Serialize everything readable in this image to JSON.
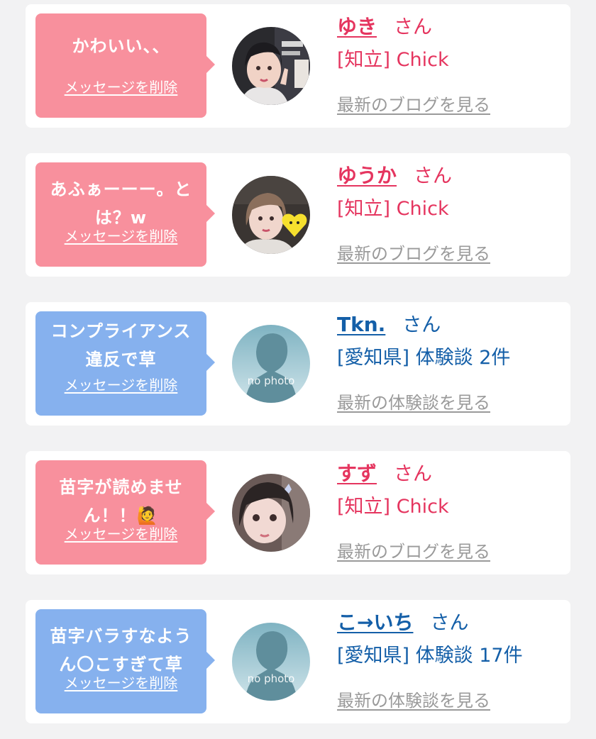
{
  "cards": [
    {
      "message": "かわいい、、",
      "delete_label": "メッセージを削除",
      "name": "ゆき",
      "honorific": "さん",
      "meta": "[知立] Chick",
      "link": "最新のブログを見る",
      "bubble_color": "#f8909d",
      "avatar": "photo-avatar"
    },
    {
      "message": "あふぁーーー。と\nは？w",
      "delete_label": "メッセージを削除",
      "name": "ゆうか",
      "honorific": "さん",
      "meta": "[知立] Chick",
      "link": "最新のブログを見る",
      "bubble_color": "#f8909d",
      "avatar": "photo-avatar"
    },
    {
      "message": "コンプライアンス\n違反で草",
      "delete_label": "メッセージを削除",
      "name": "Tkn.",
      "honorific": "さん",
      "meta": "[愛知県] 体験談 2件",
      "link": "最新の体験談を見る",
      "bubble_color": "#86b1ee",
      "avatar": "no-photo-avatar",
      "avatar_text": "no photo"
    },
    {
      "message": "苗字が読めませ\nん！！🙋",
      "delete_label": "メッセージを削除",
      "name": "すず",
      "honorific": "さん",
      "meta": "[知立] Chick",
      "link": "最新のブログを見る",
      "bubble_color": "#f8909d",
      "avatar": "photo-avatar"
    },
    {
      "message": "苗字バラすなよう\nん〇こすぎて草",
      "delete_label": "メッセージを削除",
      "name": "こ→いち",
      "honorific": "さん",
      "meta": "[愛知県] 体験談 17件",
      "link": "最新の体験談を見る",
      "bubble_color": "#86b1ee",
      "avatar": "no-photo-avatar",
      "avatar_text": "no photo"
    }
  ],
  "colors": {
    "page_bg": "#f2f2f3",
    "chick_text": "#e5355f",
    "user_text": "#145fa8",
    "link_gray": "#9a9a9a"
  }
}
